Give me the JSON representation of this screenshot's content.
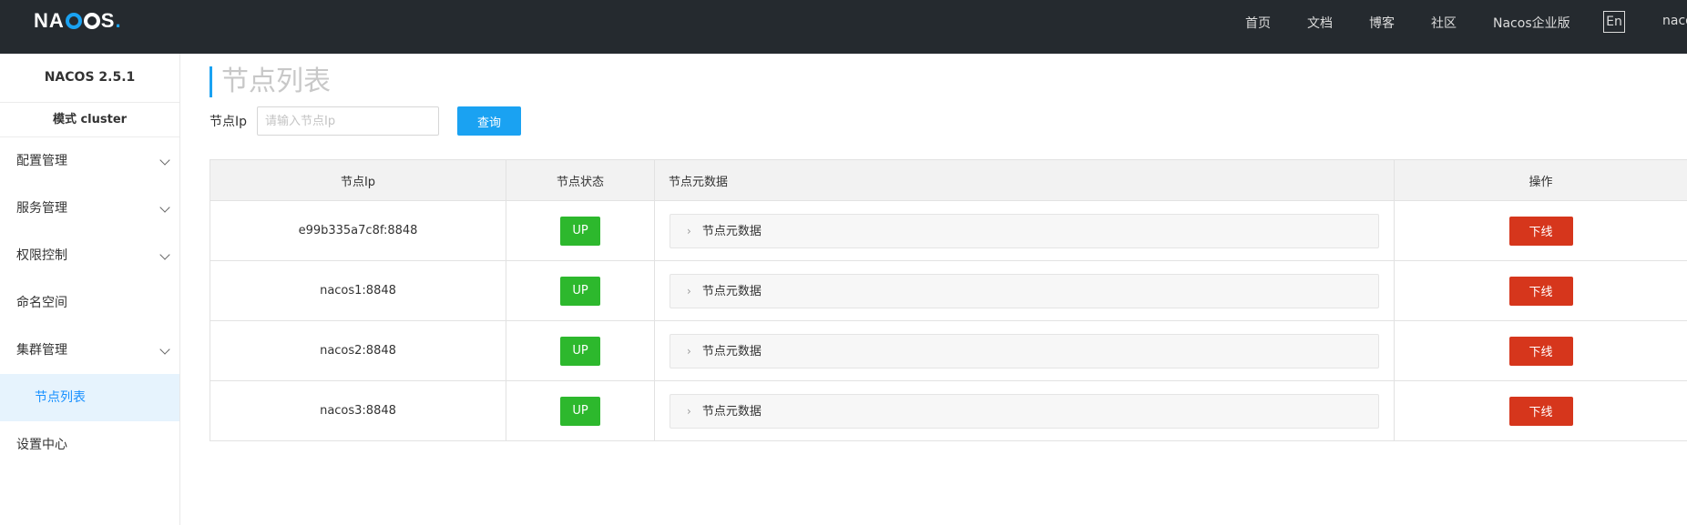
{
  "topbar": {
    "logo_prefix": "NA",
    "logo_suffix": "S",
    "nav": [
      "首页",
      "文档",
      "博客",
      "社区",
      "Nacos企业版"
    ],
    "lang": "En",
    "user": "naco"
  },
  "sidebar": {
    "version": "NACOS 2.5.1",
    "mode": "模式 cluster",
    "items": [
      {
        "label": "配置管理",
        "expandable": true
      },
      {
        "label": "服务管理",
        "expandable": true
      },
      {
        "label": "权限控制",
        "expandable": true
      },
      {
        "label": "命名空间",
        "expandable": false
      },
      {
        "label": "集群管理",
        "expandable": true
      }
    ],
    "active_sub": "节点列表",
    "last_item": "设置中心"
  },
  "main": {
    "title": "节点列表",
    "search_label": "节点Ip",
    "search_placeholder": "请输入节点Ip",
    "query_label": "查询",
    "table": {
      "headers": [
        "节点Ip",
        "节点状态",
        "节点元数据",
        "操作"
      ],
      "rows": [
        {
          "ip": "e99b335a7c8f:8848",
          "state": "UP",
          "meta": "节点元数据",
          "action": "下线"
        },
        {
          "ip": "nacos1:8848",
          "state": "UP",
          "meta": "节点元数据",
          "action": "下线"
        },
        {
          "ip": "nacos2:8848",
          "state": "UP",
          "meta": "节点元数据",
          "action": "下线"
        },
        {
          "ip": "nacos3:8848",
          "state": "UP",
          "meta": "节点元数据",
          "action": "下线"
        }
      ]
    }
  },
  "colors": {
    "topbar_bg": "#252a2f",
    "accent": "#1aa2f2",
    "status_up": "#2db82d",
    "danger": "#d6361c"
  }
}
